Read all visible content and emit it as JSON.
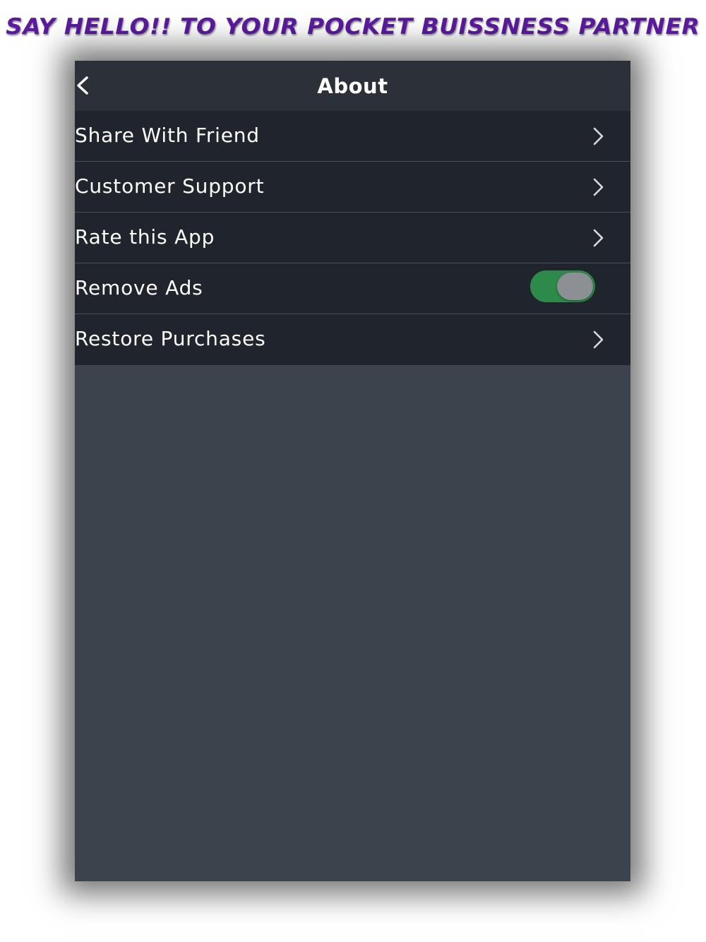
{
  "banner": {
    "text": "Say Hello!! to your Pocket Buissness Partner"
  },
  "navbar": {
    "title": "About",
    "back_icon": "chevron-left-icon"
  },
  "menu": {
    "items": [
      {
        "label": "Share With Friend",
        "accessory": "chevron-right-icon"
      },
      {
        "label": "Customer Support",
        "accessory": "chevron-right-icon"
      },
      {
        "label": "Rate this App",
        "accessory": "chevron-right-icon"
      },
      {
        "label": "Remove Ads",
        "accessory": "toggle",
        "toggle_on": true
      },
      {
        "label": "Restore Purchases",
        "accessory": "chevron-right-icon"
      }
    ]
  },
  "colors": {
    "banner_text": "#5b1a9e",
    "navbar_bg": "#2c3139",
    "row_bg": "#20252d",
    "content_bg": "#3c434c",
    "toggle_on": "#2e8a4a"
  }
}
